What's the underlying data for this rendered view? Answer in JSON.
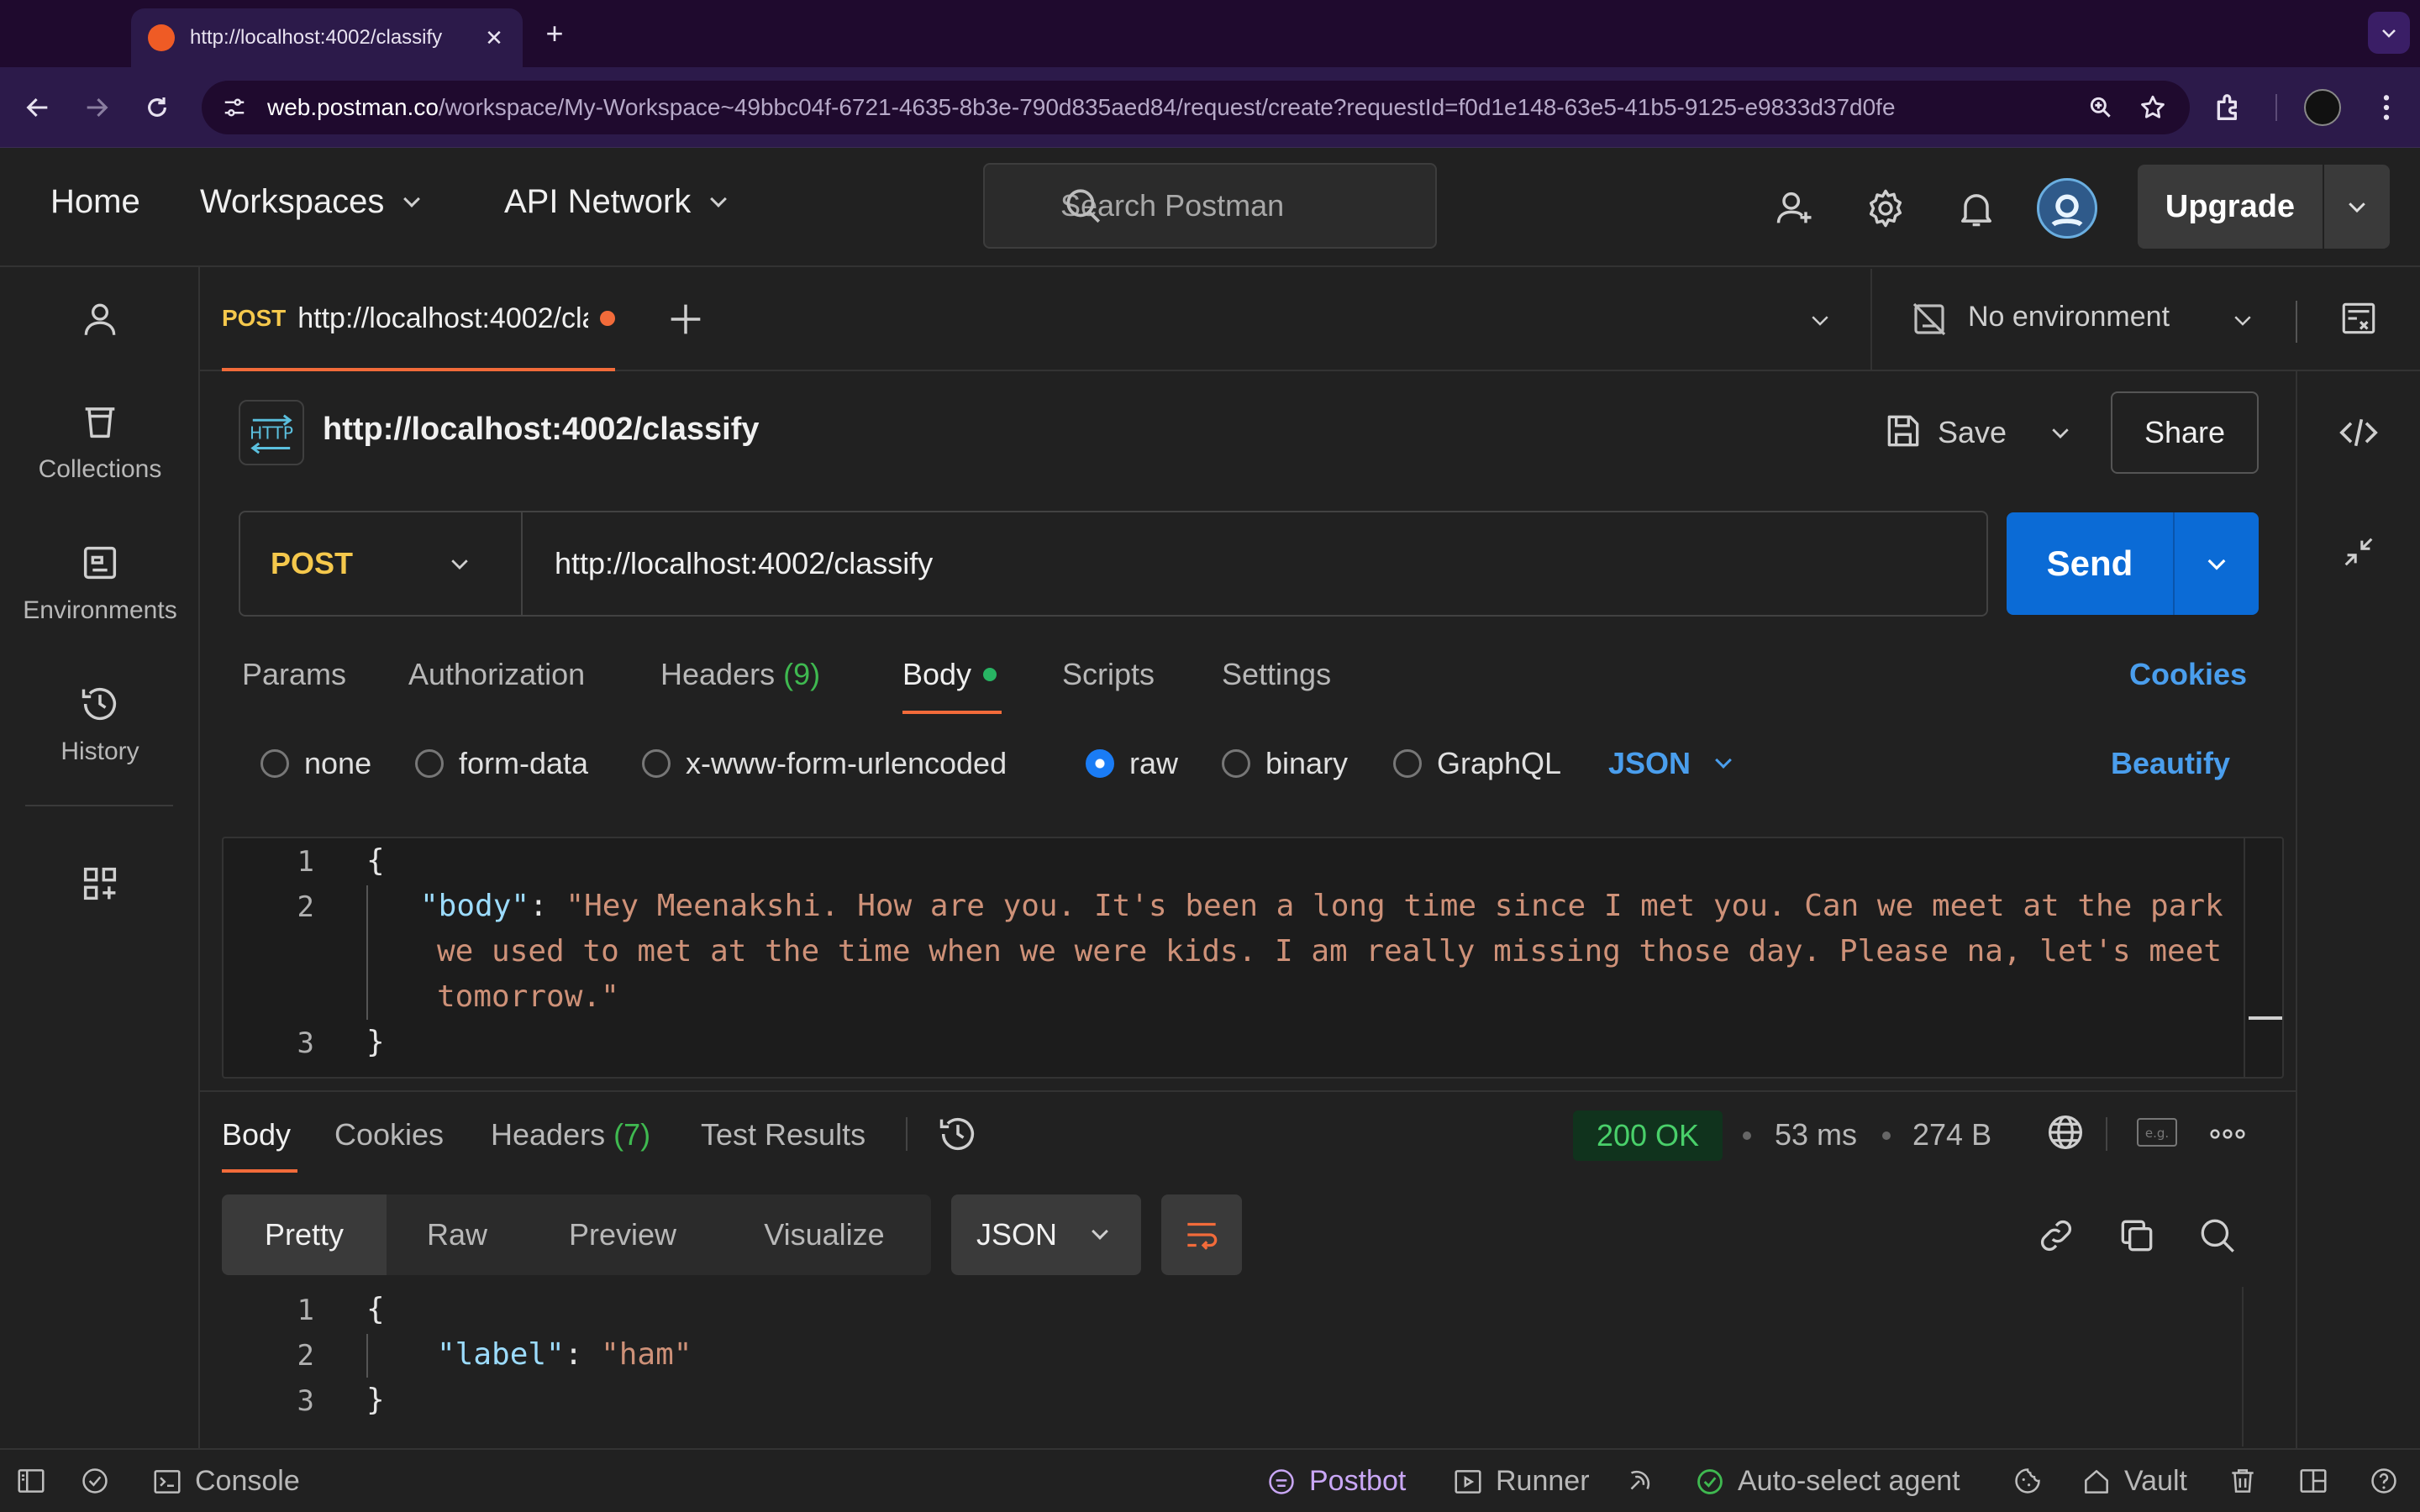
{
  "browser": {
    "tab_title": "http://localhost:4002/classify",
    "tab_close_glyph": "✕",
    "new_tab_glyph": "+",
    "url_domain": "web.postman.co",
    "url_path": "/workspace/My-Workspace~49bbc04f-6721-4635-8b3e-790d835aed84/request/create?requestId=f0d1e148-63e5-41b5-9125-e9833d37d0fe"
  },
  "header": {
    "home": "Home",
    "workspaces": "Workspaces",
    "api_network": "API Network",
    "search_placeholder": "Search Postman",
    "upgrade": "Upgrade"
  },
  "sidebar": {
    "items": [
      {
        "label": "Collections",
        "icon": "trash-bin-icon"
      },
      {
        "label": "Environments",
        "icon": "environment-icon"
      },
      {
        "label": "History",
        "icon": "history-icon"
      }
    ]
  },
  "request_tab": {
    "method": "POST",
    "url": "http://localhost:4002/classify"
  },
  "environment": {
    "label": "No environment"
  },
  "request": {
    "name": "http://localhost:4002/classify",
    "save": "Save",
    "share": "Share",
    "method": "POST",
    "url": "http://localhost:4002/classify",
    "send": "Send",
    "tabs": {
      "params": "Params",
      "authorization": "Authorization",
      "headers": "Headers",
      "headers_count": "(9)",
      "body": "Body",
      "scripts": "Scripts",
      "settings": "Settings"
    },
    "cookies": "Cookies",
    "body_types": [
      "none",
      "form-data",
      "x-www-form-urlencoded",
      "raw",
      "binary",
      "GraphQL"
    ],
    "body_format": "JSON",
    "beautify": "Beautify",
    "editor": {
      "line_numbers": [
        "1",
        "2",
        "3"
      ],
      "open_brace": "{",
      "close_brace": "}",
      "key": "\"body\"",
      "colon": ": ",
      "value_line_1": "\"Hey Meenakshi. How are you. It's been a long time since I met you. Can we meet at the park",
      "value_line_2": "we used to met at the time when we were kids. I am really missing those day. Please na, let's meet",
      "value_line_3": "tomorrow.\""
    }
  },
  "response": {
    "tabs": {
      "body": "Body",
      "cookies": "Cookies",
      "headers": "Headers",
      "headers_count": "(7)",
      "test_results": "Test Results"
    },
    "status": "200 OK",
    "time": "53 ms",
    "size": "274 B",
    "example_label": "e.g.",
    "view_modes": [
      "Pretty",
      "Raw",
      "Preview",
      "Visualize"
    ],
    "format": "JSON",
    "editor": {
      "line_numbers": [
        "1",
        "2",
        "3"
      ],
      "open_brace": "{",
      "close_brace": "}",
      "key": "\"label\"",
      "colon": ": ",
      "value": "\"ham\""
    }
  },
  "status_bar": {
    "console": "Console",
    "postbot": "Postbot",
    "runner": "Runner",
    "auto_select_agent": "Auto-select agent",
    "vault": "Vault"
  },
  "colors": {
    "accent_orange": "#f26b3a",
    "send_blue": "#0b6bd6",
    "method_yellow": "#f5c84c",
    "link_blue": "#4a9eed",
    "status_green": "#49d06a"
  }
}
